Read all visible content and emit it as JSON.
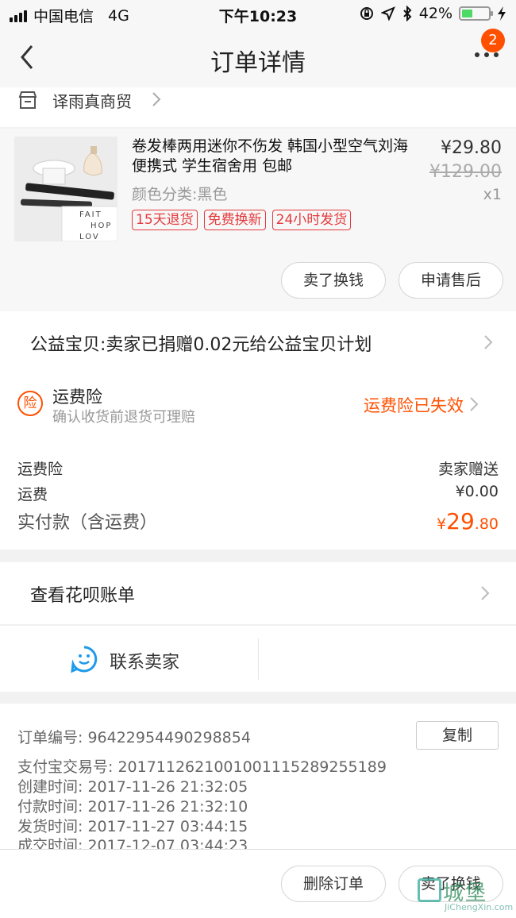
{
  "status_bar": {
    "carrier": "中国电信",
    "network": "4G",
    "time": "下午10:23",
    "battery": "42%",
    "battery_level": 0.42
  },
  "nav": {
    "title": "订单详情",
    "badge": "2"
  },
  "shop": {
    "name": "译雨真商贸"
  },
  "item": {
    "title": "卷发棒两用迷你不伤发 韩国小型空气刘海 便携式 学生宿舍用 包邮",
    "spec": "颜色分类:黑色",
    "price": "¥29.80",
    "original_price": "¥129.00",
    "qty": "x1",
    "tags": [
      "15天退货",
      "免费换新",
      "24小时发货"
    ],
    "thumb_text": [
      "FAIT",
      "HOP",
      "LOV"
    ],
    "buttons": {
      "sell": "卖了换钱",
      "after_sale": "申请售后"
    }
  },
  "charity": {
    "text": "公益宝贝:卖家已捐赠0.02元给公益宝贝计划"
  },
  "insurance": {
    "icon_char": "险",
    "name": "运费险",
    "desc": "确认收货前退货可理赔",
    "status": "运费险已失效"
  },
  "fees": {
    "insurance_label": "运费险",
    "insurance_value": "卖家赠送",
    "shipping_label": "运费",
    "shipping_value": "¥0.00",
    "total_label": "实付款（含运费）",
    "total_currency": "¥",
    "total_int": "29",
    "total_dec": ".80"
  },
  "huabei": {
    "text": "查看花呗账单"
  },
  "contact": {
    "label": "联系卖家"
  },
  "order_info": {
    "copy_label": "复制",
    "lines": [
      "订单编号:  96422954490298854",
      "支付宝交易号:  2017112621001001115289255189",
      "创建时间:  2017-11-26 21:32:05",
      "付款时间:  2017-11-26 21:32:10",
      "发货时间:  2017-11-27 03:44:15",
      "成交时间:  2017-12-07 03:44:23"
    ]
  },
  "bottom": {
    "delete_label": "删除订单",
    "sell_label": "卖了换钱"
  },
  "watermark": {
    "cn": "城堡",
    "en": "JiChengXin.com"
  },
  "colors": {
    "accent": "#ff5000",
    "tag_red": "#e4393c",
    "blue": "#1e9be9"
  }
}
